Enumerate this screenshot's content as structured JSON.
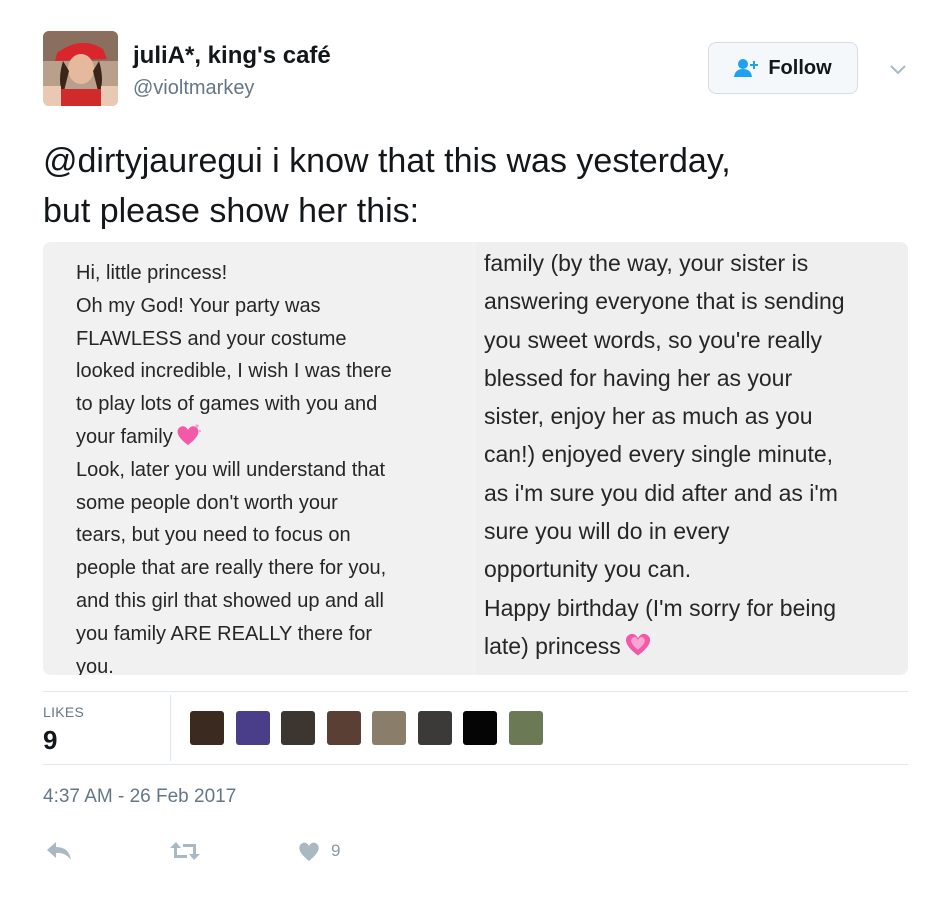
{
  "user": {
    "display_name": "juliA*, king's café",
    "handle": "@violtmarkey",
    "avatar": "avatar-photo"
  },
  "follow_button": {
    "label": "Follow",
    "icon": "add-user-icon"
  },
  "tweet": {
    "text_lines": [
      "@dirtyjauregui i know that this was yesterday,",
      "but please show her this:"
    ]
  },
  "image": {
    "left_lines": [
      "Hi, little princess!",
      "Oh my God! Your party was",
      "FLAWLESS and your costume",
      "looked incredible, I wish I was there",
      "to play lots of games with you and",
      "your family",
      "Look, later you will understand that",
      "some people don't worth your",
      "tears, but you need to focus on",
      "people that are really there for you,",
      "and this girl that showed up and all",
      "you family ARE REALLY there for",
      "you."
    ],
    "right_lines": [
      "family (by the way, your sister is",
      "answering everyone that is sending",
      "you sweet words, so you're really",
      "blessed for having her as your",
      "sister, enjoy her as much as you",
      "can!) enjoyed every single minute,",
      "as i'm sure you did after and as i'm",
      "sure you will do in every",
      "opportunity you can.",
      "Happy birthday (I'm sorry for being",
      "late) princess"
    ],
    "emoji": "sparkling-heart-icon"
  },
  "stats": {
    "likes_label": "LIKES",
    "likes_count": "9",
    "likers": [
      "#3a2a20",
      "#4a3d8a",
      "#3d3530",
      "#5a4034",
      "#8a7e6a",
      "#3c3a38",
      "#050505",
      "#6b7a55"
    ]
  },
  "timestamp": "4:37 AM - 26 Feb 2017",
  "actions": {
    "reply_icon": "reply-icon",
    "retweet_icon": "retweet-icon",
    "like_icon": "heart-icon",
    "like_count": "9"
  },
  "colors": {
    "muted": "#657786",
    "follow_icon": "#1da1f2",
    "action_icon": "#aab8c2"
  }
}
